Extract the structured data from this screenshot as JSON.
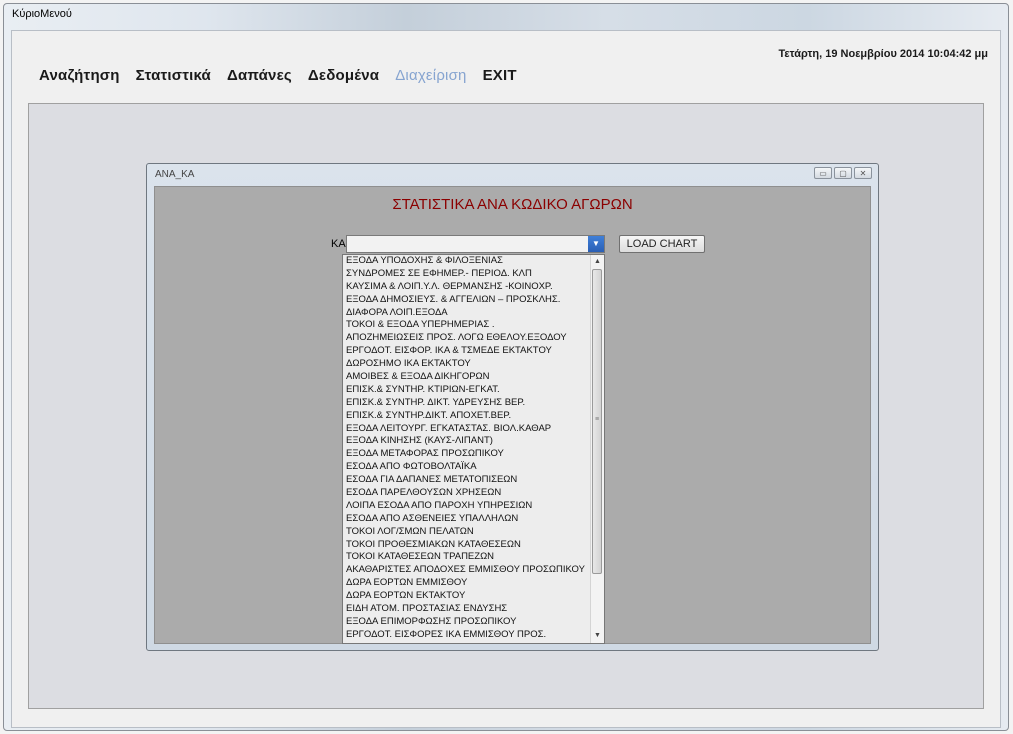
{
  "window": {
    "title": "ΚύριοΜενού",
    "datetime": "Τετάρτη, 19 Νοεμβρίου 2014 10:04:42 μμ"
  },
  "menu": [
    {
      "label": "Αναζήτηση",
      "enabled": true
    },
    {
      "label": "Στατιστικά",
      "enabled": true
    },
    {
      "label": "Δαπάνες",
      "enabled": true
    },
    {
      "label": "Δεδομένα",
      "enabled": true
    },
    {
      "label": "Διαχείριση",
      "enabled": false
    },
    {
      "label": "EXIT",
      "enabled": true
    }
  ],
  "child": {
    "title": "ANA_KA",
    "controls": {
      "minimize": "▭",
      "maximize": "▢",
      "close": "✕"
    },
    "heading": "ΣΤΑΤΙΣΤΙΚΑ ΑΝΑ ΚΩΔΙΚΟ ΑΓΩΡΩΝ",
    "ka_label": "ΚΑ:",
    "ka_value": "",
    "load_button": "LOAD CHART",
    "dropdown_items": [
      "ΕΞΟΔΑ ΥΠΟΔΟΧΗΣ & ΦΙΛΟΞΕΝΙΑΣ",
      "ΣΥΝΔΡΟΜΕΣ ΣΕ ΕΦΗΜΕΡ.- ΠΕΡΙΟΔ. ΚΛΠ",
      "ΚΑΥΣΙΜΑ & ΛΟΙΠ.Υ.Λ. ΘΕΡΜΑΝΣΗΣ -ΚΟΙΝΟΧΡ.",
      "ΕΞΟΔΑ ΔΗΜΟΣΙΕΥΣ. & ΑΓΓΕΛΙΩΝ – ΠΡΟΣΚΛΗΣ.",
      "ΔΙΑΦΟΡΑ ΛΟΙΠ.ΕΞΟΔΑ",
      "ΤΟΚΟΙ & ΕΞΟΔΑ ΥΠΕΡΗΜΕΡΙΑΣ .",
      "ΑΠΟΖΗΜΕΙΩΣΕΙΣ ΠΡΟΣ. ΛΟΓΩ ΕΘΕΛΟΥ.ΕΞΟΔΟΥ",
      "ΕΡΓΟΔΟΤ. ΕΙΣΦΟΡ. ΙΚΑ & ΤΣΜΕΔΕ ΕΚΤΑΚΤΟΥ",
      "ΔΩΡΟΣΗΜΟ ΙΚΑ ΕΚΤΑΚΤΟΥ",
      "ΑΜΟΙΒΕΣ & ΕΞΟΔΑ ΔΙΚΗΓΟΡΩΝ",
      "ΕΠΙΣΚ.& ΣΥΝΤΗΡ. ΚΤΙΡΙΩΝ-ΕΓΚΑΤ.",
      "ΕΠΙΣΚ.& ΣΥΝΤΗΡ. ΔΙΚΤ. ΥΔΡΕΥΣΗΣ ΒΕΡ.",
      "ΕΠΙΣΚ.& ΣΥΝΤΗΡ.ΔΙΚΤ. ΑΠΟΧΕΤ.ΒΕΡ.",
      "ΕΞΟΔΑ ΛΕΙΤΟΥΡΓ. ΕΓΚΑΤΑΣΤΑΣ. ΒΙΟΛ.ΚΑΘΑΡ",
      "ΕΞΟΔΑ ΚΙΝΗΣΗΣ (ΚΑΥΣ-ΛΙΠΑΝΤ)",
      "ΕΞΟΔΑ ΜΕΤΑΦΟΡΑΣ ΠΡΟΣΩΠΙΚΟΥ",
      "ΕΣΟΔΑ ΑΠΟ ΦΩΤΟΒΟΛΤΑΪΚΑ",
      "ΕΣΟΔΑ ΓΙΑ ΔΑΠΑΝΕΣ ΜΕΤΑΤΟΠΙΣΕΩΝ",
      "ΕΣΟΔΑ ΠΑΡΕΛΘΟΥΣΩΝ ΧΡΗΣΕΩΝ",
      "ΛΟΙΠΑ ΕΣΟΔΑ ΑΠΟ ΠΑΡΟΧΗ ΥΠΗΡΕΣΙΩΝ",
      "ΕΣΟΔΑ ΑΠΟ ΑΣΘΕΝΕΙΕΣ ΥΠΑΛΛΗΛΩΝ",
      "ΤΟΚΟΙ ΛΟΓ/ΣΜΩΝ ΠΕΛΑΤΩΝ",
      "ΤΟΚΟΙ ΠΡΟΘΕΣΜΙΑΚΩΝ ΚΑΤΑΘΕΣΕΩΝ",
      "ΤΟΚΟΙ ΚΑΤΑΘΕΣΕΩΝ ΤΡΑΠΕΖΩΝ",
      "ΑΚΑΘΑΡΙΣΤΕΣ ΑΠΟΔΟΧΕΣ ΕΜΜΙΣΘΟΥ ΠΡΟΣΩΠΙΚΟΥ",
      "ΔΩΡΑ ΕΟΡΤΩΝ ΕΜΜΙΣΘΟΥ",
      "ΔΩΡΑ ΕΟΡΤΩΝ ΕΚΤΑΚΤΟΥ",
      "ΕΙΔΗ ΑΤΟΜ. ΠΡΟΣΤΑΣΙΑΣ ΕΝΔΥΣΗΣ",
      "ΕΞΟΔΑ ΕΠΙΜΟΡΦΩΣΗΣ ΠΡΟΣΩΠΙΚΟΥ",
      "ΕΡΓΟΔΟΤ. ΕΙΣΦΟΡΕΣ ΙΚΑ ΕΜΜΙΣΘΟΥ ΠΡΟΣ."
    ],
    "scrollbar": {
      "up": "▲",
      "down": "▼",
      "grip": "≡"
    },
    "dropdown_arrow": "▼"
  },
  "colors": {
    "heading": "#8b0000",
    "disabled_menu": "#86a4d0",
    "dropdown_button": "#2a5fb5"
  }
}
